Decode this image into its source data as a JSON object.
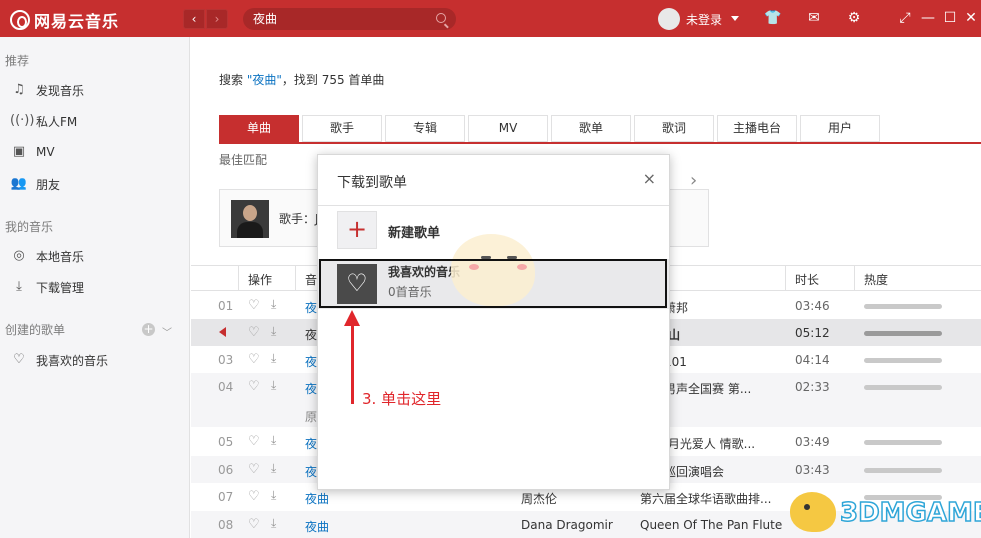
{
  "app": {
    "name": "网易云音乐"
  },
  "topbar": {
    "back": "‹",
    "forward": "›",
    "search_value": "夜曲",
    "login": "未登录"
  },
  "sidebar": {
    "sections": [
      {
        "title": "推荐"
      },
      {
        "title": "我的音乐"
      },
      {
        "title": "创建的歌单"
      }
    ],
    "recommend": [
      "发现音乐",
      "私人FM",
      "MV",
      "朋友"
    ],
    "my_music": [
      "本地音乐",
      "下载管理"
    ],
    "playlists": [
      "我喜欢的音乐"
    ]
  },
  "main": {
    "result_prefix": "搜索 ",
    "result_keyword": "\"夜曲\"",
    "result_suffix": "，找到 755 首单曲",
    "tabs": [
      "单曲",
      "歌手",
      "专辑",
      "MV",
      "歌单",
      "歌词",
      "主播电台",
      "用户"
    ],
    "best_match": "最佳匹配",
    "artist_label": "歌手：J",
    "columns": [
      "操作",
      "音",
      "时长",
      "热度"
    ],
    "rows": [
      {
        "num": "01",
        "name": "夜",
        "singer": "",
        "album": "的的萧邦",
        "duration": "03:46"
      },
      {
        "num": "",
        "name": "夜",
        "singer": "",
        "album": "四季 山",
        "duration": "05:12"
      },
      {
        "num": "03",
        "name": "夜",
        "singer": "",
        "album": "心情101",
        "duration": "04:14"
      },
      {
        "num": "04",
        "name": "夜",
        "singer": "",
        "album": "快乐男声全国赛 第...",
        "duration": "02:33"
      },
      {
        "num": "",
        "name": "原",
        "singer": "",
        "album": "",
        "duration": ""
      },
      {
        "num": "05",
        "name": "夜",
        "singer": "",
        "album": "边境 月光爱人 情歌...",
        "duration": "03:49"
      },
      {
        "num": "06",
        "name": "夜",
        "singer": "",
        "album": "世界巡回演唱会",
        "duration": "03:43"
      },
      {
        "num": "07",
        "name": "夜曲",
        "singer": "周杰伦",
        "album": "第六届全球华语歌曲排...",
        "duration": ""
      },
      {
        "num": "08",
        "name": "夜曲",
        "singer": "Dana Dragomir",
        "album": "Queen Of The Pan Flute",
        "duration": ""
      }
    ]
  },
  "modal": {
    "title": "下载到歌单",
    "close": "×",
    "new_playlist": "新建歌单",
    "fav_title": "我喜欢的音乐",
    "fav_count": "0首音乐"
  },
  "annotation": {
    "text": "3. 单击这里"
  },
  "watermark": {
    "text": "3DMGAME"
  },
  "colors": {
    "brand": "#c62f2f",
    "link": "#0c73c2",
    "annotation": "#e0262b"
  }
}
